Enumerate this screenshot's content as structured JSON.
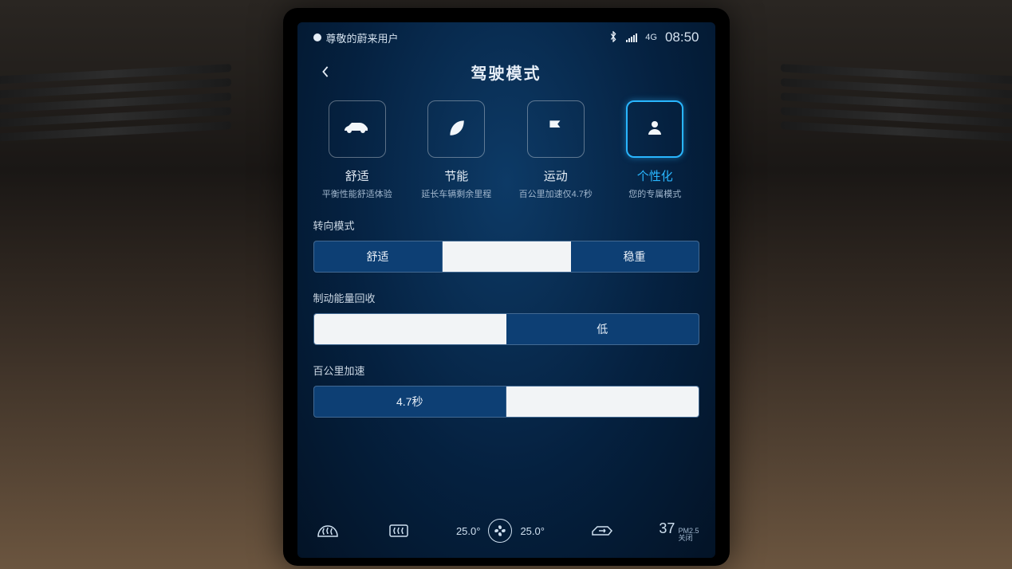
{
  "statusbar": {
    "user_label": "尊敬的蔚来用户",
    "network": "4G",
    "time": "08:50"
  },
  "header": {
    "title": "驾驶模式"
  },
  "modes": [
    {
      "id": "comfort",
      "icon": "car-side-icon",
      "label": "舒适",
      "desc": "平衡性能舒适体验",
      "selected": false
    },
    {
      "id": "eco",
      "icon": "leaf-icon",
      "label": "节能",
      "desc": "延长车辆剩余里程",
      "selected": false
    },
    {
      "id": "sport",
      "icon": "flag-icon",
      "label": "运动",
      "desc": "百公里加速仅4.7秒",
      "selected": false
    },
    {
      "id": "custom",
      "icon": "person-icon",
      "label": "个性化",
      "desc": "您的专属模式",
      "selected": true
    }
  ],
  "settings": {
    "steering": {
      "label": "转向模式",
      "options": [
        {
          "label": "舒适",
          "active": false
        },
        {
          "label": "",
          "active": true
        },
        {
          "label": "稳重",
          "active": false
        }
      ]
    },
    "regen": {
      "label": "制动能量回收",
      "options": [
        {
          "label": "",
          "active": true
        },
        {
          "label": "低",
          "active": false
        }
      ]
    },
    "accel": {
      "label": "百公里加速",
      "options": [
        {
          "label": "4.7秒",
          "active": false
        },
        {
          "label": "",
          "active": true
        }
      ]
    }
  },
  "bottom": {
    "temp_left": "25.0°",
    "temp_right": "25.0°",
    "aq_value": "37",
    "aq_label_top": "PM2.5",
    "aq_label_bottom": "关闭"
  }
}
